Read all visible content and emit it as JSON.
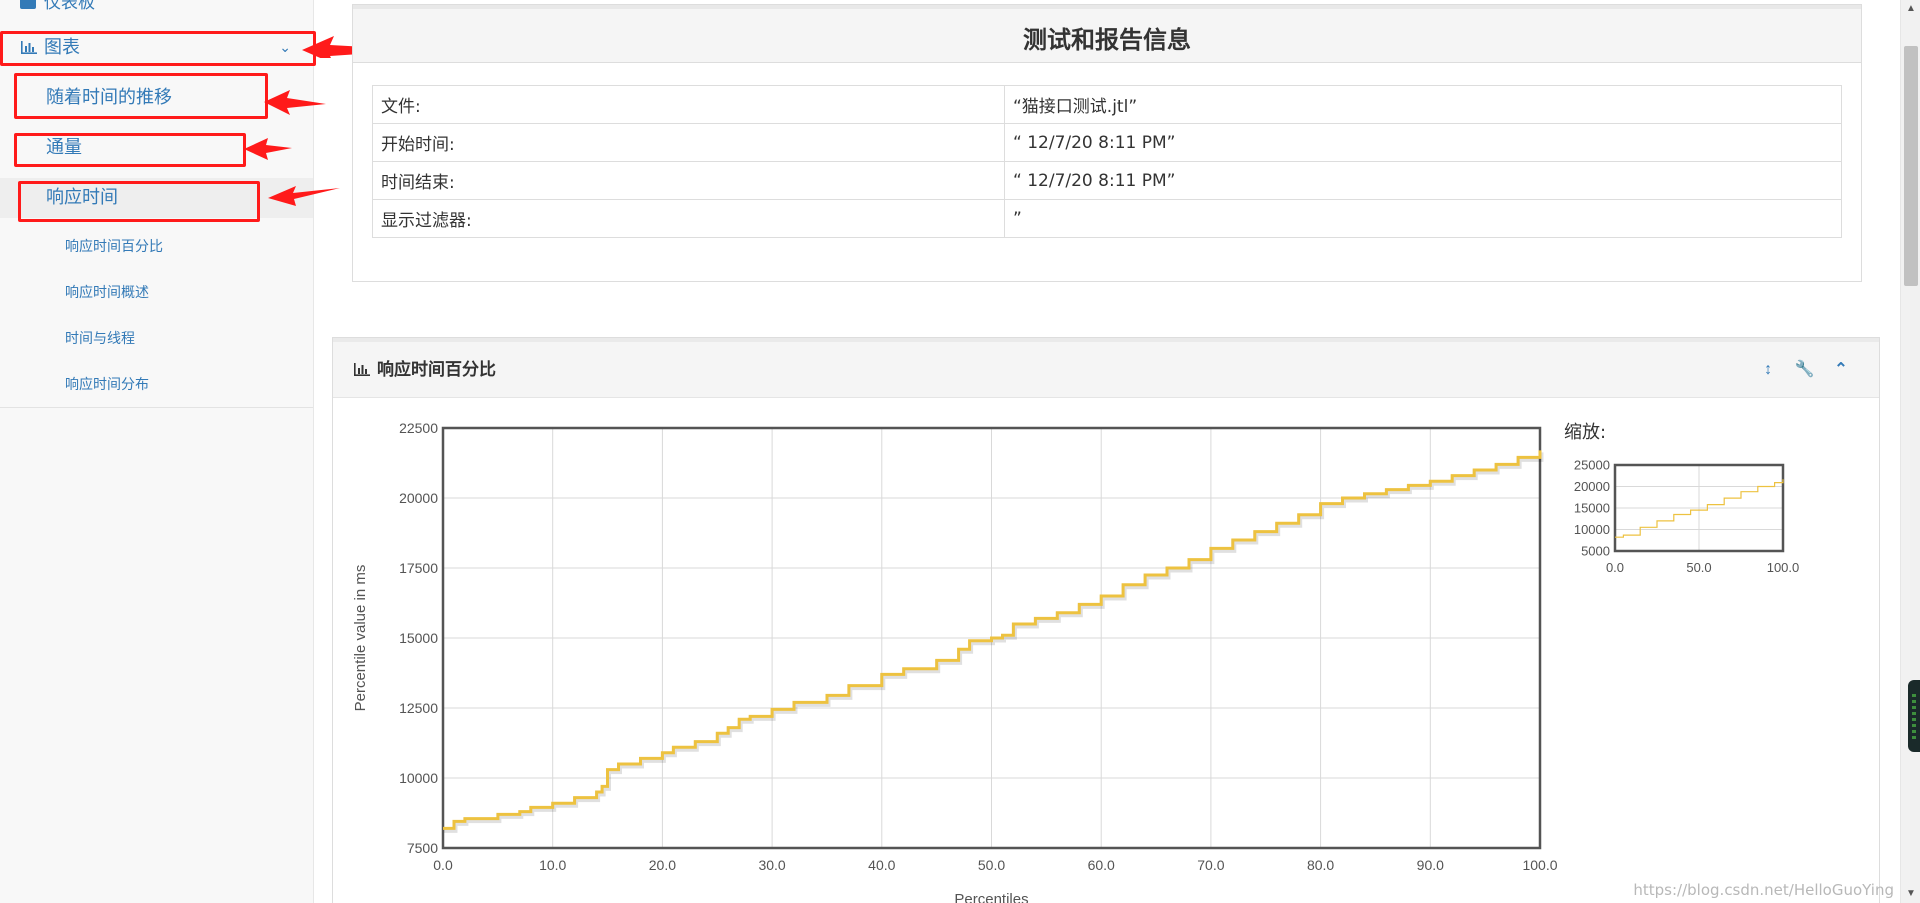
{
  "sidebar": {
    "dashboard_label": "仪表板",
    "charts_label": "图表",
    "sub_items": [
      "随着时间的推移",
      "通量",
      "响应时间"
    ],
    "response_items": [
      "响应时间百分比",
      "响应时间概述",
      "时间与线程",
      "响应时间分布"
    ]
  },
  "info": {
    "title": "测试和报告信息",
    "rows": [
      {
        "key": "文件:",
        "value": "“猫接口测试.jtl”"
      },
      {
        "key": "开始时间:",
        "value": "“ 12/7/20 8:11 PM”"
      },
      {
        "key": "时间结束:",
        "value": "“ 12/7/20 8:11 PM”"
      },
      {
        "key": "显示过滤器:",
        "value": "”"
      }
    ]
  },
  "panel": {
    "title": "响应时间百分比",
    "zoom_label": "缩放:"
  },
  "watermark": "https://blog.csdn.net/HelloGuoYing",
  "colors": {
    "accent": "#337ab7",
    "series": "#edc240",
    "annotation": "#ff1a1a"
  },
  "chart_data": [
    {
      "type": "line",
      "title": "",
      "xlabel": "Percentiles",
      "ylabel": "Percentile value in ms",
      "xlim": [
        0,
        100
      ],
      "ylim": [
        7500,
        22500
      ],
      "x_ticks": [
        "0.0",
        "10.0",
        "20.0",
        "30.0",
        "40.0",
        "50.0",
        "60.0",
        "70.0",
        "80.0",
        "90.0",
        "100.0"
      ],
      "y_ticks": [
        "7500",
        "10000",
        "12500",
        "15000",
        "17500",
        "20000",
        "22500"
      ],
      "grid": true,
      "series": [
        {
          "x": [
            0,
            1,
            2,
            5,
            7,
            8,
            10,
            12,
            14,
            14.5,
            15,
            16,
            18,
            20,
            21,
            23,
            25,
            26,
            27,
            28,
            30,
            32,
            35,
            37,
            40,
            42,
            45,
            47,
            48,
            50,
            51,
            52,
            54,
            56,
            58,
            60,
            62,
            64,
            66,
            68,
            70,
            72,
            74,
            76,
            78,
            80,
            82,
            84,
            86,
            88,
            90,
            92,
            94,
            96,
            98,
            100
          ],
          "y": [
            8200,
            8450,
            8550,
            8700,
            8800,
            8950,
            9100,
            9300,
            9500,
            9700,
            10300,
            10500,
            10700,
            10900,
            11100,
            11300,
            11600,
            11800,
            12100,
            12200,
            12450,
            12700,
            12950,
            13300,
            13700,
            13900,
            14200,
            14600,
            14900,
            15000,
            15100,
            15500,
            15700,
            15900,
            16200,
            16500,
            16900,
            17250,
            17500,
            17800,
            18200,
            18500,
            18800,
            19100,
            19400,
            19800,
            20000,
            20150,
            20300,
            20450,
            20600,
            20800,
            21000,
            21200,
            21450,
            21700
          ]
        }
      ]
    },
    {
      "type": "line",
      "title": "",
      "xlim": [
        0,
        100
      ],
      "ylim": [
        5000,
        25000
      ],
      "x_ticks": [
        "0.0",
        "50.0",
        "100.0"
      ],
      "y_ticks": [
        "5000",
        "10000",
        "15000",
        "20000",
        "25000"
      ],
      "grid": true,
      "series": [
        {
          "x": [
            0,
            5,
            15,
            25,
            35,
            45,
            55,
            65,
            75,
            85,
            95,
            100
          ],
          "y": [
            8200,
            8700,
            10500,
            12000,
            13500,
            14500,
            15800,
            17300,
            18800,
            20000,
            20900,
            21700
          ]
        }
      ]
    }
  ]
}
